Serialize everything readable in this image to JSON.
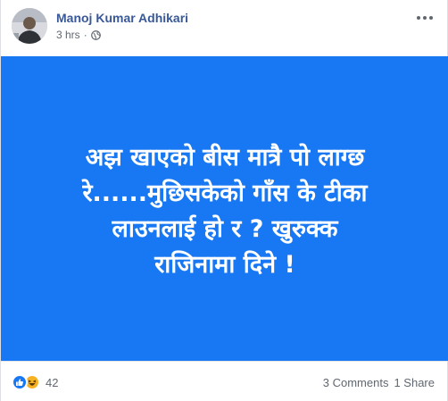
{
  "post": {
    "author": "Manoj Kumar Adhikari",
    "timestamp": "3 hrs",
    "separator": "·",
    "privacy_icon": "globe-icon",
    "more_icon": "more-options-icon"
  },
  "media": {
    "background_color": "#1877f2",
    "text_lines": [
      "अझ खाएको बीस मात्रै पो लाग्छ",
      "रे......मुछिसकेको गाँस के टीका",
      "लाउनलाई हो र ? खुरुक्क",
      "राजिनामा दिने !"
    ]
  },
  "footer": {
    "reaction_icons": [
      "like-icon",
      "haha-icon"
    ],
    "reaction_count": "42",
    "comments": "3 Comments",
    "shares": "1 Share"
  },
  "colors": {
    "author_link": "#385898",
    "meta_text": "#616770",
    "like": "#1877f2",
    "haha": "#f7b125"
  }
}
